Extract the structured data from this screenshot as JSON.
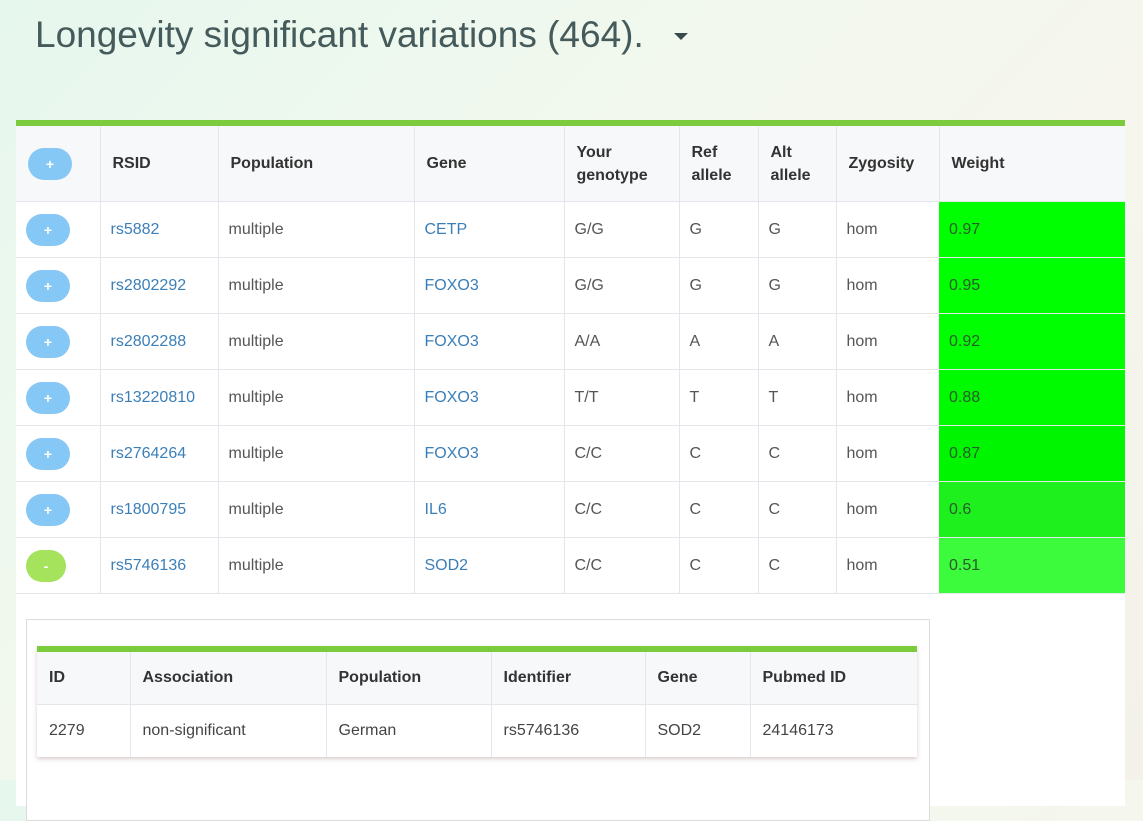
{
  "title": "Longevity significant variations (464).",
  "toggle_all_label": "+",
  "columns": [
    "RSID",
    "Population",
    "Gene",
    "Your genotype",
    "Ref allele",
    "Alt allele",
    "Zygosity",
    "Weight"
  ],
  "rows": [
    {
      "toggle": "+",
      "rsid": "rs5882",
      "population": "multiple",
      "gene": "CETP",
      "genotype": "G/G",
      "ref": "G",
      "alt": "G",
      "zygosity": "hom",
      "weight": "0.97",
      "weight_color": "#00ff00"
    },
    {
      "toggle": "+",
      "rsid": "rs2802292",
      "population": "multiple",
      "gene": "FOXO3",
      "genotype": "G/G",
      "ref": "G",
      "alt": "G",
      "zygosity": "hom",
      "weight": "0.95",
      "weight_color": "#00ff00"
    },
    {
      "toggle": "+",
      "rsid": "rs2802288",
      "population": "multiple",
      "gene": "FOXO3",
      "genotype": "A/A",
      "ref": "A",
      "alt": "A",
      "zygosity": "hom",
      "weight": "0.92",
      "weight_color": "#00ff00"
    },
    {
      "toggle": "+",
      "rsid": "rs13220810",
      "population": "multiple",
      "gene": "FOXO3",
      "genotype": "T/T",
      "ref": "T",
      "alt": "T",
      "zygosity": "hom",
      "weight": "0.88",
      "weight_color": "#00fa00"
    },
    {
      "toggle": "+",
      "rsid": "rs2764264",
      "population": "multiple",
      "gene": "FOXO3",
      "genotype": "C/C",
      "ref": "C",
      "alt": "C",
      "zygosity": "hom",
      "weight": "0.87",
      "weight_color": "#00f500"
    },
    {
      "toggle": "+",
      "rsid": "rs1800795",
      "population": "multiple",
      "gene": "IL6",
      "genotype": "C/C",
      "ref": "C",
      "alt": "C",
      "zygosity": "hom",
      "weight": "0.6",
      "weight_color": "#1ef01e"
    },
    {
      "toggle": "-",
      "rsid": "rs5746136",
      "population": "multiple",
      "gene": "SOD2",
      "genotype": "C/C",
      "ref": "C",
      "alt": "C",
      "zygosity": "hom",
      "weight": "0.51",
      "weight_color": "#3cfa3c"
    }
  ],
  "details": {
    "columns": [
      "ID",
      "Association",
      "Population",
      "Identifier",
      "Gene",
      "Pubmed ID"
    ],
    "rows": [
      {
        "id": "2279",
        "association": "non-significant",
        "population": "German",
        "identifier": "rs5746136",
        "gene": "SOD2",
        "pubmed": "24146173"
      }
    ]
  },
  "colors": {
    "accent_green": "#7ccb3c",
    "pill_blue": "#86c8f5",
    "pill_green": "#a6e35c",
    "link_blue": "#3b7fb8",
    "title": "#455a5a"
  }
}
